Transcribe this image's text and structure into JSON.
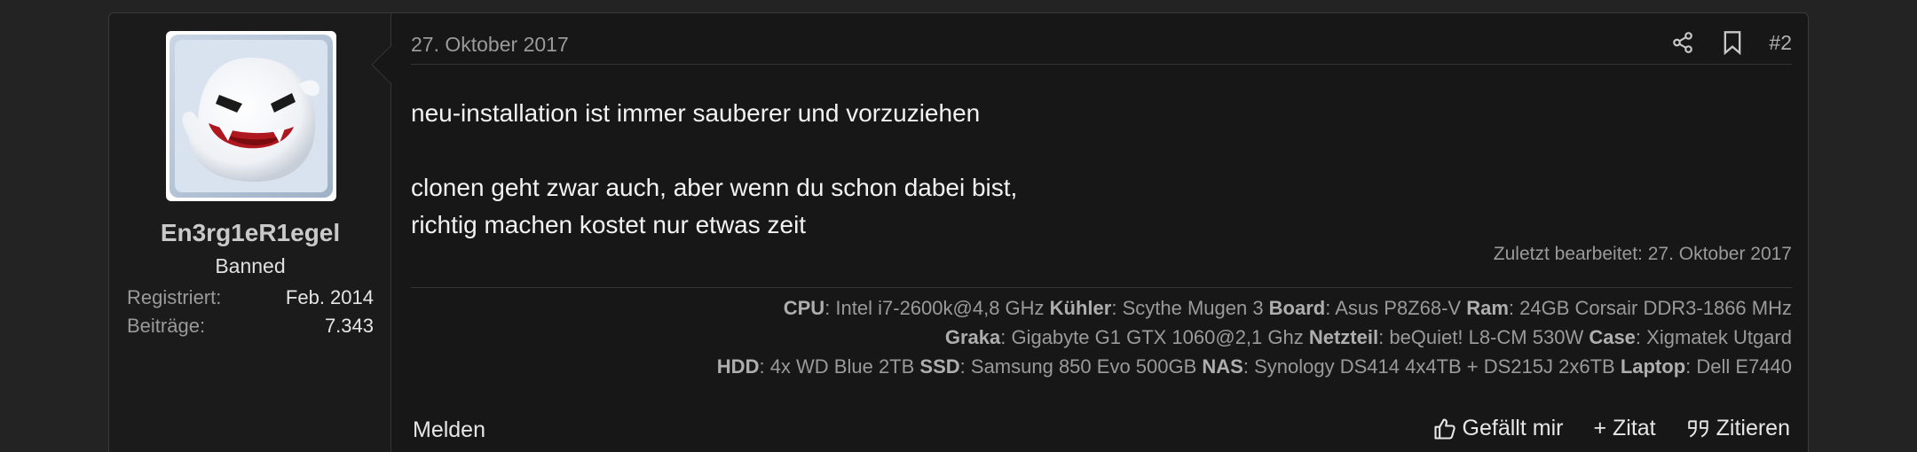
{
  "user": {
    "name": "En3rg1eR1egel",
    "title": "Banned",
    "registered_label": "Registriert:",
    "registered_value": "Feb. 2014",
    "posts_label": "Beiträge:",
    "posts_value": "7.343"
  },
  "post": {
    "date": "27. Oktober 2017",
    "number": "#2",
    "lines": [
      "neu-installation ist immer sauberer und vorzuziehen",
      "clonen geht zwar auch, aber wenn du schon dabei bist,",
      "richtig machen kostet nur etwas zeit"
    ],
    "edited": "Zuletzt bearbeitet: 27. Oktober 2017"
  },
  "signature": {
    "line1": [
      {
        "k": "CPU",
        "v": ": Intel i7-2600k@4,8 GHz "
      },
      {
        "k": "Kühler",
        "v": ": Scythe Mugen 3 "
      },
      {
        "k": "Board",
        "v": ": Asus P8Z68-V "
      },
      {
        "k": "Ram",
        "v": ": 24GB Corsair DDR3-1866 MHz"
      }
    ],
    "line2": [
      {
        "k": "Graka",
        "v": ": Gigabyte G1 GTX 1060@2,1 Ghz "
      },
      {
        "k": "Netzteil",
        "v": ": beQuiet! L8-CM 530W "
      },
      {
        "k": "Case",
        "v": ": Xigmatek Utgard"
      }
    ],
    "line3": [
      {
        "k": "HDD",
        "v": ": 4x WD Blue 2TB "
      },
      {
        "k": "SSD",
        "v": ": Samsung 850 Evo 500GB "
      },
      {
        "k": "NAS",
        "v": ": Synology DS414 4x4TB + DS215J 2x6TB "
      },
      {
        "k": "Laptop",
        "v": ": Dell E7440"
      }
    ]
  },
  "footer": {
    "report": "Melden",
    "like": "Gefällt mir",
    "quote_plus": "+ Zitat",
    "quote": "Zitieren"
  },
  "icons": {
    "share": "share-icon",
    "bookmark": "bookmark-icon",
    "like": "thumbs-up-icon",
    "quote": "quote-icon"
  }
}
